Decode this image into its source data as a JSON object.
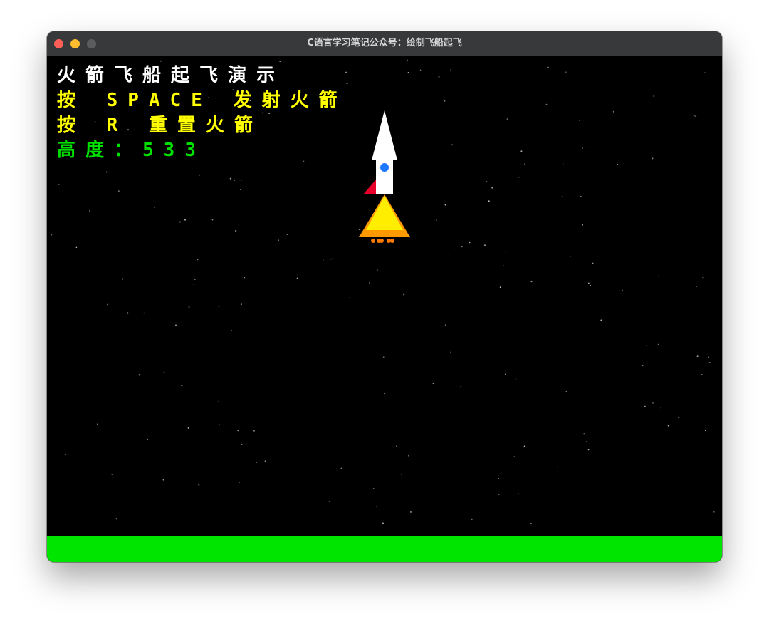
{
  "window": {
    "title": "C语言学习笔记公众号：绘制飞船起飞"
  },
  "hud": {
    "title": "火箭飞船起飞演示",
    "launch_hint": "按 SPACE 发射火箭",
    "reset_hint": "按 R 重置火箭",
    "height_label": "高度：",
    "height_value": "533"
  },
  "colors": {
    "title_text": "#ffffff",
    "hint_text": "#ffff00",
    "height_text": "#00e000",
    "ground": "#00e500",
    "rocket_body": "#ffffff",
    "rocket_window": "#1e78ff",
    "rocket_fin": "#e8002a",
    "flame_outer": "#ff9900",
    "flame_inner": "#ffee00"
  },
  "icons": {
    "close": "close-button-icon",
    "minimize": "minimize-button-icon",
    "maximize": "maximize-button-icon"
  }
}
